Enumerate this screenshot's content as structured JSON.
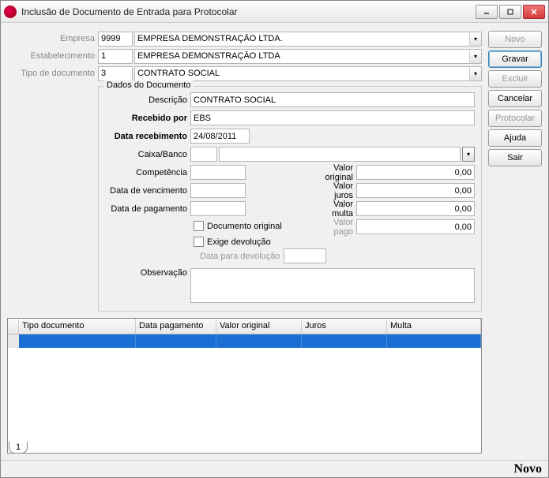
{
  "window": {
    "title": "Inclusão de Documento de Entrada para Protocolar"
  },
  "top": {
    "empresa_label": "Empresa",
    "empresa_code": "9999",
    "empresa_name": "EMPRESA DEMONSTRAÇÃO LTDA.",
    "estab_label": "Estabelecimento",
    "estab_code": "1",
    "estab_name": "EMPRESA DEMONSTRAÇÃO LTDA",
    "tipodoc_label": "Tipo de documento",
    "tipodoc_code": "3",
    "tipodoc_name": "CONTRATO SOCIAL"
  },
  "fieldset": {
    "legend": "Dados do Documento",
    "descricao_label": "Descrição",
    "descricao": "CONTRATO SOCIAL",
    "recebido_label": "Recebido por",
    "recebido": "EBS",
    "data_receb_label": "Data recebimento",
    "data_receb": "24/08/2011",
    "caixa_label": "Caixa/Banco",
    "caixa_code": "",
    "caixa_name": "",
    "competencia_label": "Competência",
    "competencia": "",
    "valor_original_label": "Valor original",
    "valor_original": "0,00",
    "data_venc_label": "Data de vencimento",
    "data_venc": "",
    "valor_juros_label": "Valor juros",
    "valor_juros": "0,00",
    "data_pag_label": "Data de pagamento",
    "data_pag": "",
    "valor_multa_label": "Valor multa",
    "valor_multa": "0,00",
    "doc_original_label": "Documento original",
    "valor_pago_label": "Valor pago",
    "valor_pago": "0,00",
    "exige_devol_label": "Exige devolução",
    "data_devol_label": "Data para devolução",
    "data_devol": "",
    "observacao_label": "Observação",
    "observacao": ""
  },
  "buttons": {
    "novo": "Novo",
    "gravar": "Gravar",
    "excluir": "Excluir",
    "cancelar": "Cancelar",
    "protocolar": "Protocolar",
    "ajuda": "Ajuda",
    "sair": "Sair"
  },
  "grid": {
    "headers": [
      "Tipo documento",
      "Data pagamento",
      "Valor original",
      "Juros",
      "Multa"
    ]
  },
  "tab": {
    "name": "1"
  },
  "status": {
    "mode": "Novo"
  }
}
